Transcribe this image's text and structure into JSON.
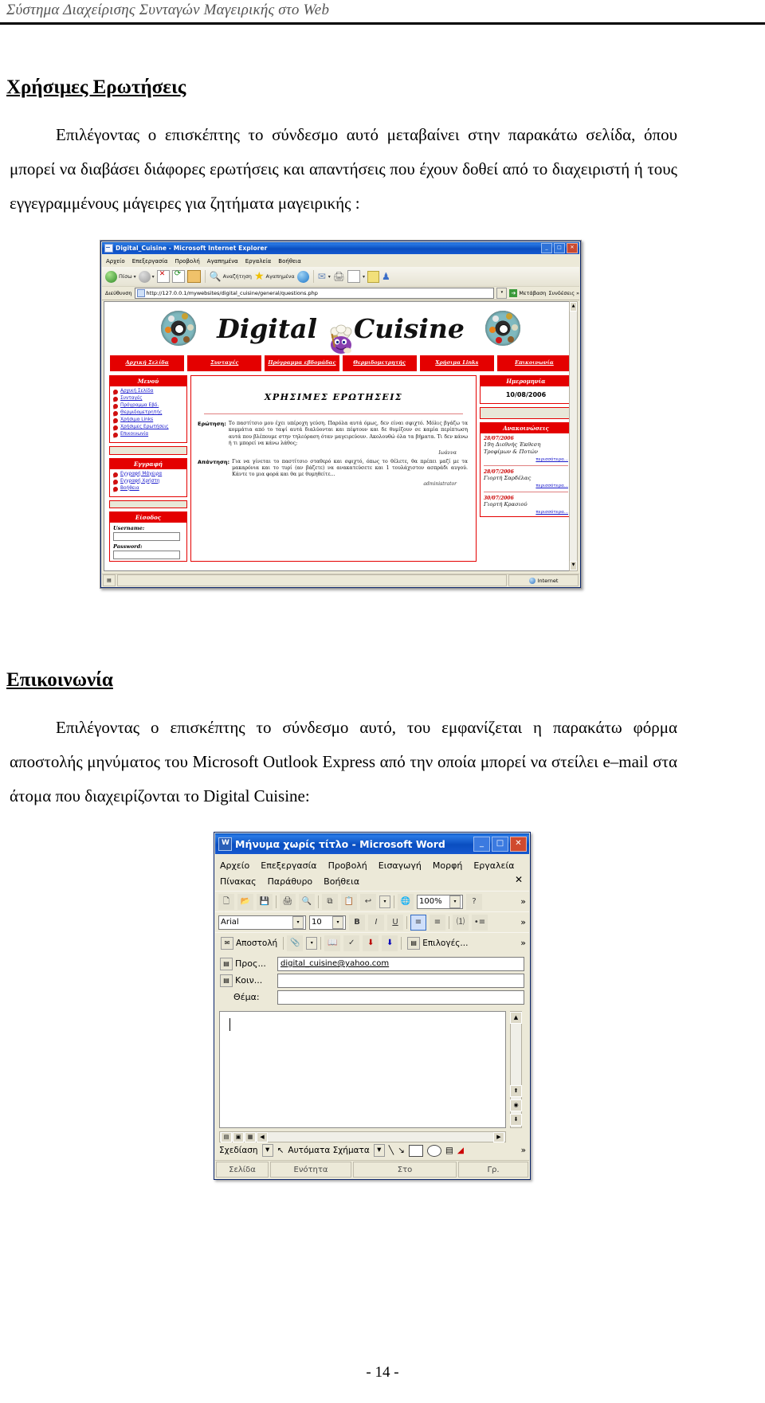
{
  "document": {
    "running_header": "Σύστημα Διαχείρισης Συνταγών Μαγειρικής στο Web",
    "page_number": "- 14 -",
    "sections": [
      {
        "heading": "Χρήσιμες Ερωτήσεις",
        "paragraph": "Επιλέγοντας ο επισκέπτης το σύνδεσμο αυτό μεταβαίνει στην παρακάτω σελίδα, όπου μπορεί να διαβάσει διάφορες ερωτήσεις και απαντήσεις που έχουν δοθεί από το διαχειριστή ή τους εγγεγραμμένους μάγειρες για ζητήματα μαγειρικής :"
      },
      {
        "heading": "Επικοινωνία",
        "paragraph": "Επιλέγοντας ο επισκέπτης το σύνδεσμο αυτό, του εμφανίζεται η παρακάτω φόρμα αποστολής μηνύματος του Microsoft Outlook Express από την οποία μπορεί να στείλει e–mail στα άτομα που διαχειρίζονται το Digital Cuisine:"
      }
    ]
  },
  "browser": {
    "window_title": "Digital_Cuisine - Microsoft Internet Explorer",
    "title_buttons": [
      "_",
      "□",
      "✕"
    ],
    "menu": [
      "Αρχείο",
      "Επεξεργασία",
      "Προβολή",
      "Αγαπημένα",
      "Εργαλεία",
      "Βοήθεια"
    ],
    "toolbar": {
      "back_label": "Πίσω",
      "search_label": "Αναζήτηση",
      "favorites_label": "Αγαπημένα"
    },
    "address": {
      "label": "Διεύθυνση",
      "url": "http://127.0.0.1/mywebsites/digital_cuisine/general/questions.php",
      "go_label": "Μετάβαση",
      "links_label": "Συνδέσεις"
    },
    "status": {
      "zone": "Internet"
    }
  },
  "site": {
    "logo_left": "Digital",
    "logo_right": "Cuisine",
    "nav": [
      "Αρχική Σελίδα",
      "Συνταγές",
      "Πρόγραμμα εβδομάδας",
      "Θερμιδομετρητής",
      "Χρήσιμα Links",
      "Επικοινωνία"
    ],
    "sidebar_left": {
      "menu_header": "Μενού",
      "menu_items": [
        "Αρχική Σελίδα",
        "Συνταγές",
        "Πρόγραμμα Εβδ.",
        "Θερμιδομετρητής",
        "Χρήσιμα Links",
        "Χρήσιμες Ερωτήσεις",
        "Επικοινωνία"
      ],
      "register_header": "Εγγραφή",
      "register_items": [
        "Εγγραφή Μάγειρα",
        "Εγγραφή Χρήστη",
        "Βοήθεια"
      ],
      "login_header": "Είσοδος",
      "username_label": "Username:",
      "password_label": "Password:"
    },
    "main": {
      "title": "ΧΡΗΣΙΜΕΣ ΕΡΩΤΗΣΕΙΣ",
      "question_tag": "Ερώτηση:",
      "question_text": "Το παστίτσιο μου έχει υπέροχη γεύση. Παρόλα αυτά όμως, δεν είναι σφιχτό. Μόλις βγάζω τα κομμάτια από το ταψί αυτά διαλύονται και πέφτουν και δε θυμίζουν σε καμία περίπτωση αυτά που βλέπουμε στην τηλεόραση όταν μαγειρεύουν. Ακολουθώ όλα τα βήματα. Τι δεν κάνω ή τι μπορεί να κάνω λάθος;",
      "question_signature": "Ιωάννα",
      "answer_tag": "Απάντηση:",
      "answer_text": "Για να γίνεται το παστίτσιο σταθερό και σφιχτό, όπως το θέλετε, θα πρέπει μαζί με τα μακαρόνια και το τυρί (αν βάζετε) να ανακατεύσετε και 1 τουλάχιστον ασπράδι αυγού. Κάντε το μια φορά και θα με θυμηθείτε...",
      "answer_signature": "administrator"
    },
    "sidebar_right": {
      "date_header": "Ημερομηνία",
      "date_value": "10/08/2006",
      "announcements_header": "Ανακοινώσεις",
      "more_label": "περισσότερα...",
      "items": [
        {
          "date": "28/07/2006",
          "text": "19η Διεθνής Έκθεση Τροφίμων & Ποτών"
        },
        {
          "date": "28/07/2006",
          "text": "Γιορτή Σαρδέλας"
        },
        {
          "date": "30/07/2006",
          "text": "Γιορτή Κρασιού"
        }
      ]
    }
  },
  "mail_window": {
    "window_title": "Μήνυμα χωρίς τίτλο - Microsoft Word",
    "title_buttons": [
      "_",
      "□",
      "✕"
    ],
    "menu_row1": [
      "Αρχείο",
      "Επεξεργασία",
      "Προβολή",
      "Εισαγωγή",
      "Μορφή",
      "Εργαλεία"
    ],
    "menu_row2": [
      "Πίνακας",
      "Παράθυρο",
      "Βοήθεια"
    ],
    "close_doc_glyph": "✕",
    "zoom_value": "100%",
    "font_name": "Arial",
    "font_size": "10",
    "bold_glyph": "B",
    "italic_glyph": "I",
    "underline_glyph": "U",
    "send_label": "Αποστολή",
    "options_label": "Επιλογές...",
    "to_label": "Προς...",
    "cc_label": "Κοιν...",
    "subject_label": "Θέμα:",
    "to_value": "digital_cuisine@yahoo.com",
    "cc_value": "",
    "subject_value": "",
    "body_value": "",
    "draw_label": "Σχεδίαση",
    "autoshapes_label": "Αυτόματα Σχήματα",
    "status": [
      "Σελίδα",
      "Ενότητα",
      "Στο",
      "Γρ."
    ]
  },
  "colors": {
    "brand_red": "#e40000",
    "title_blue": "#0a4ec0",
    "link_blue": "#1a1acc",
    "chrome": "#ece9d8"
  }
}
